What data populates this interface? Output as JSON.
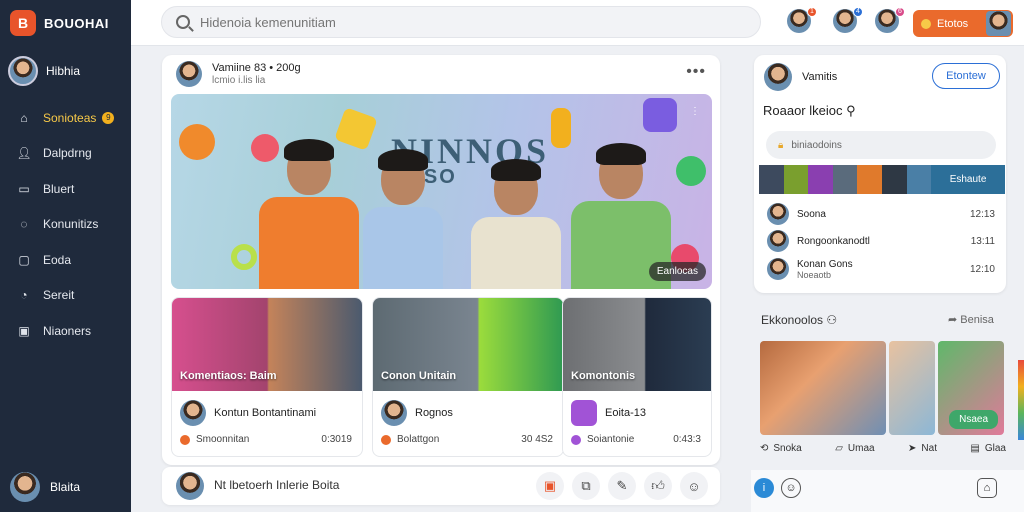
{
  "brand": {
    "logo": "B",
    "name": "BOUOHAI"
  },
  "profile": {
    "name": "Hibhia"
  },
  "nav": [
    {
      "label": "Sonioteas",
      "icon": "home-icon",
      "badge": "9",
      "active": true
    },
    {
      "label": "Dalpdrng",
      "icon": "user-icon"
    },
    {
      "label": "Bluert",
      "icon": "bookmark-icon"
    },
    {
      "label": "Konunitizs",
      "icon": "chat-icon"
    },
    {
      "label": "Eoda",
      "icon": "file-icon"
    },
    {
      "label": "Sereit",
      "icon": "compass-icon"
    },
    {
      "label": "Niaoners",
      "icon": "briefcase-icon"
    }
  ],
  "bottom_user": {
    "name": "Blaita"
  },
  "search": {
    "placeholder": "Hidenoia kemenunitiam"
  },
  "top_icons": {
    "badge1": "1",
    "badge2": "4",
    "badge3": "6"
  },
  "cta": {
    "label": "Etotos"
  },
  "post": {
    "author": "Vamiine 83 • 200g",
    "meta": "lcmio i.lis lia",
    "hero_title": "NINNOS",
    "hero_sub": "VISO",
    "hero_tag": "Eanlocas",
    "hero_more": "⋮"
  },
  "subcards": [
    {
      "caption": "Komentiaos: Baim",
      "name": "Kontun Bontantinami",
      "foot": "Smoonnitan",
      "value": "0:3019"
    },
    {
      "caption": "Conon Unitain",
      "name": "Rognos",
      "foot": "Bolattgon",
      "value": "30 4S2"
    },
    {
      "caption": "Komontonis",
      "name": "Eoita-13",
      "foot": "Soiantonie",
      "value": "0:43:3"
    }
  ],
  "composer": {
    "text": "Nt lbetoerh Inlerie Boita"
  },
  "right_panel": {
    "user": "Vamitis",
    "follow": "Etontew",
    "title": "Roaaor lkeioc",
    "search_text": "biniaodoins",
    "strip_label": "Eshaute",
    "items": [
      {
        "name": "Soona",
        "time": "12:13"
      },
      {
        "name": "Rongoonkanodtl",
        "time": "13:11"
      },
      {
        "name": "Konan Gons",
        "sub": "Noeaotb",
        "time": "12:10"
      }
    ]
  },
  "gallery": {
    "title": "Ekkonoolos",
    "link": "Benisa",
    "badge": "Nsaea"
  },
  "actions": [
    {
      "icon": "share-icon",
      "label": "Snoka"
    },
    {
      "icon": "comment-icon",
      "label": "Umaa"
    },
    {
      "icon": "forward-icon",
      "label": "Nat"
    },
    {
      "icon": "save-icon",
      "label": "Glaa"
    }
  ]
}
